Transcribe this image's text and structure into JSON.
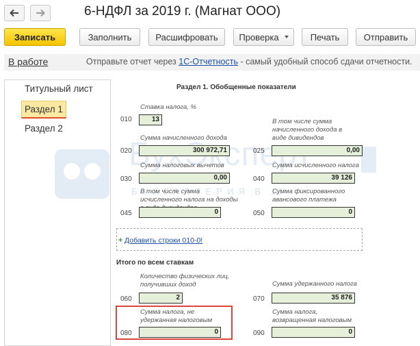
{
  "window": {
    "title": "6-НДФЛ за 2019 г. (Магнат ООО)"
  },
  "toolbar": {
    "save": "Записать",
    "fill": "Заполнить",
    "decode": "Расшифровать",
    "check": "Проверка",
    "print": "Печать",
    "send": "Отправить"
  },
  "status": {
    "state": "В работе",
    "promo_prefix": "Отправьте отчет через",
    "promo_link": "1С-Отчетность",
    "promo_suffix": "- самый удобный способ сдачи отчетности."
  },
  "sidebar": {
    "items": [
      {
        "label": "Титульный лист"
      },
      {
        "label": "Раздел 1"
      },
      {
        "label": "Раздел 2"
      }
    ]
  },
  "form": {
    "section_title": "Раздел 1. Обобщенные показатели",
    "tax_rate_label": "Ставка налога, %",
    "tax_rate_code": "010",
    "tax_rate_value": "13",
    "r020_label": "Сумма начисленного дохода",
    "r020_code": "020",
    "r020_value": "300 972,71",
    "r025_label": "В том числе сумма начисленного дохода в виде дивидендов",
    "r025_code": "025",
    "r025_value": "0,00",
    "r030_label": "Сумма налоговых вычетов",
    "r030_code": "030",
    "r030_value": "0,00",
    "r040_label": "Сумма исчисленного налога",
    "r040_code": "040",
    "r040_value": "39 126",
    "r045_label": "В том числе сумма исчисленного налога на доходы в виде дивидендов",
    "r045_code": "045",
    "r045_value": "0",
    "r050_label": "Сумма фиксированного авансового платежа",
    "r050_code": "050",
    "r050_value": "0",
    "add_rows_link": "Добавить строки 010-0!",
    "totals_title": "Итого по всем ставкам",
    "r060_label": "Количество физических лиц, получивших доход",
    "r060_code": "060",
    "r060_value": "2",
    "r070_label": "Сумма удержанного налога",
    "r070_code": "070",
    "r070_value": "35 876",
    "r080_label": "Сумма налога, не удержанная налоговым агентом",
    "r080_code": "080",
    "r080_value": "0",
    "r090_label": "Сумма налога, возвращенная налоговым агентом",
    "r090_code": "090",
    "r090_value": "0"
  },
  "watermark": {
    "brand": "БухЭксперт",
    "sub": "Б  У  Х  Г  А  Л  Т  Е  Р  И  Я    В    1С"
  }
}
